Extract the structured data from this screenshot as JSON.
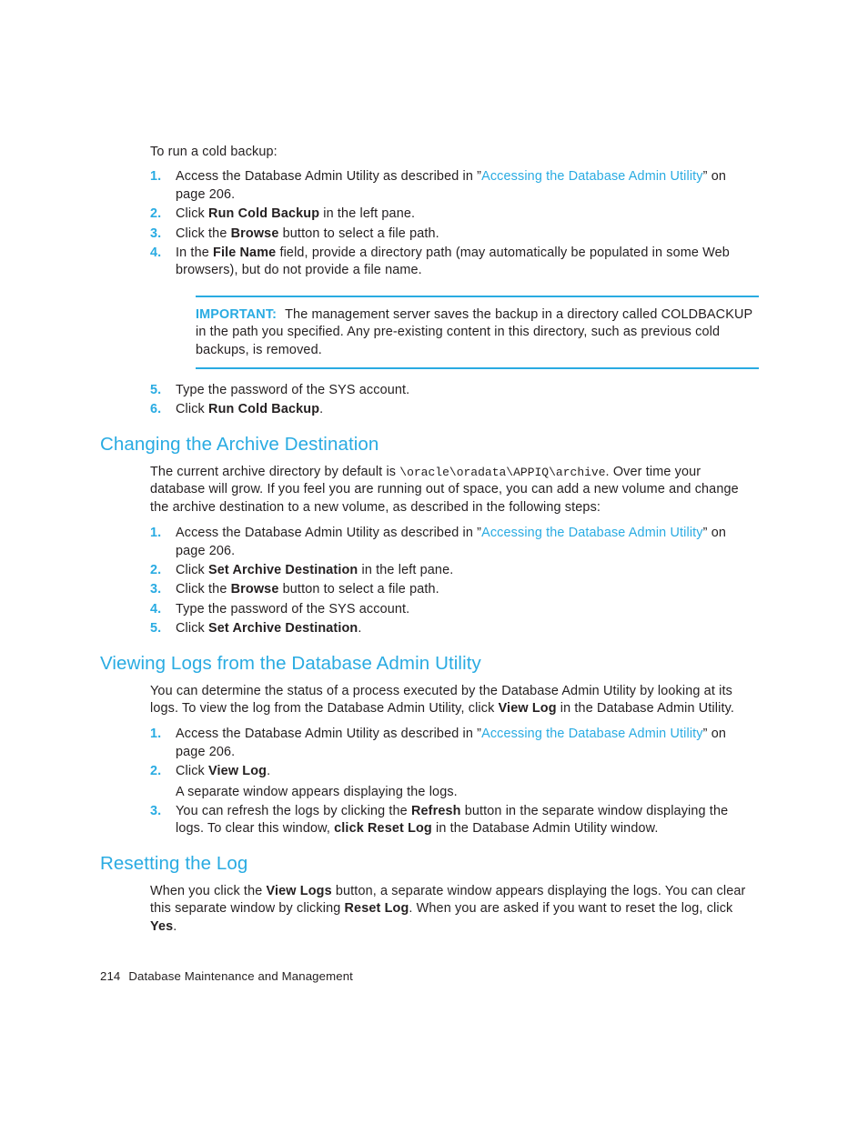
{
  "colors": {
    "heading": "#29abe2",
    "link": "#29abe2",
    "body": "#231f20",
    "rule": "#29abe2"
  },
  "intro": {
    "lead": "To run a cold backup:"
  },
  "cold_backup_steps": {
    "step1_a": "Access the Database Admin Utility as described in ",
    "step1_quote_open": "”",
    "step1_link": "Accessing the Database Admin Utility",
    "step1_quote_close": "”",
    "step1_b": " on page 206.",
    "step2_a": "Click ",
    "step2_bold": "Run Cold Backup",
    "step2_b": " in the left pane.",
    "step3_a": "Click the ",
    "step3_bold": "Browse",
    "step3_b": " button to select a file path.",
    "step4_a": "In the ",
    "step4_bold": "File Name",
    "step4_b": " field, provide a directory path (may automatically be populated in some Web browsers), but do not provide a file name.",
    "step5": "Type the password of the SYS account.",
    "step6_a": "Click ",
    "step6_bold": "Run Cold Backup",
    "step6_b": ".",
    "numbers": [
      "1.",
      "2.",
      "3.",
      "4.",
      "5.",
      "6."
    ]
  },
  "important_note": {
    "label": "IMPORTANT:",
    "text": "The management server saves the backup in a directory called COLDBACKUP in the path you specified. Any pre-existing content in this directory, such as previous cold backups, is removed."
  },
  "archive_section": {
    "heading": "Changing the Archive Destination",
    "para_a": "The current archive directory by default is ",
    "para_path": "\\oracle\\oradata\\APPIQ\\archive",
    "para_b": ". Over time your database will grow. If you feel you are running out of space, you can add a new volume and change the archive destination to a new volume, as described in the following steps:",
    "numbers": [
      "1.",
      "2.",
      "3.",
      "4.",
      "5."
    ],
    "step1_a": "Access the Database Admin Utility as described in ",
    "step1_quote_open": "”",
    "step1_link": "Accessing the Database Admin Utility",
    "step1_quote_close": "”",
    "step1_b": " on page 206.",
    "step2_a": "Click ",
    "step2_bold": "Set Archive Destination",
    "step2_b": " in the left pane.",
    "step3_a": "Click the ",
    "step3_bold": "Browse",
    "step3_b": " button to select a file path.",
    "step4": "Type the password of the SYS account.",
    "step5_a": "Click ",
    "step5_bold": "Set Archive Destination",
    "step5_b": "."
  },
  "viewing_logs_section": {
    "heading": "Viewing Logs from the Database Admin Utility",
    "para_a": "You can determine the status of a process executed by the Database Admin Utility by looking at its logs. To view the log from the Database Admin Utility, click ",
    "para_bold": "View Log",
    "para_b": " in the Database Admin Utility.",
    "numbers": [
      "1.",
      "2.",
      "3."
    ],
    "step1_a": "Access the Database Admin Utility as described in ",
    "step1_quote_open": "”",
    "step1_link": "Accessing the Database Admin Utility",
    "step1_quote_close": "”",
    "step1_b": " on page 206.",
    "step2_a": "Click ",
    "step2_bold": "View Log",
    "step2_b": ".",
    "step2_sub": "A separate window appears displaying the logs.",
    "step3_a": "You can refresh the logs by clicking the ",
    "step3_bold1": "Refresh",
    "step3_b": " button in the separate window displaying the logs. To clear this window, ",
    "step3_bold2": "click Reset Log",
    "step3_c": " in the Database Admin Utility window."
  },
  "resetting_section": {
    "heading": "Resetting the Log",
    "para_a": "When you click the ",
    "para_bold1": "View Logs",
    "para_b": " button, a separate window appears displaying the logs. You can clear this separate window by clicking ",
    "para_bold2": "Reset Log",
    "para_c": ". When you are asked if you want to reset the log, click ",
    "para_bold3": "Yes",
    "para_d": "."
  },
  "footer": {
    "page_number": "214",
    "chapter_title": "Database Maintenance and Management"
  }
}
